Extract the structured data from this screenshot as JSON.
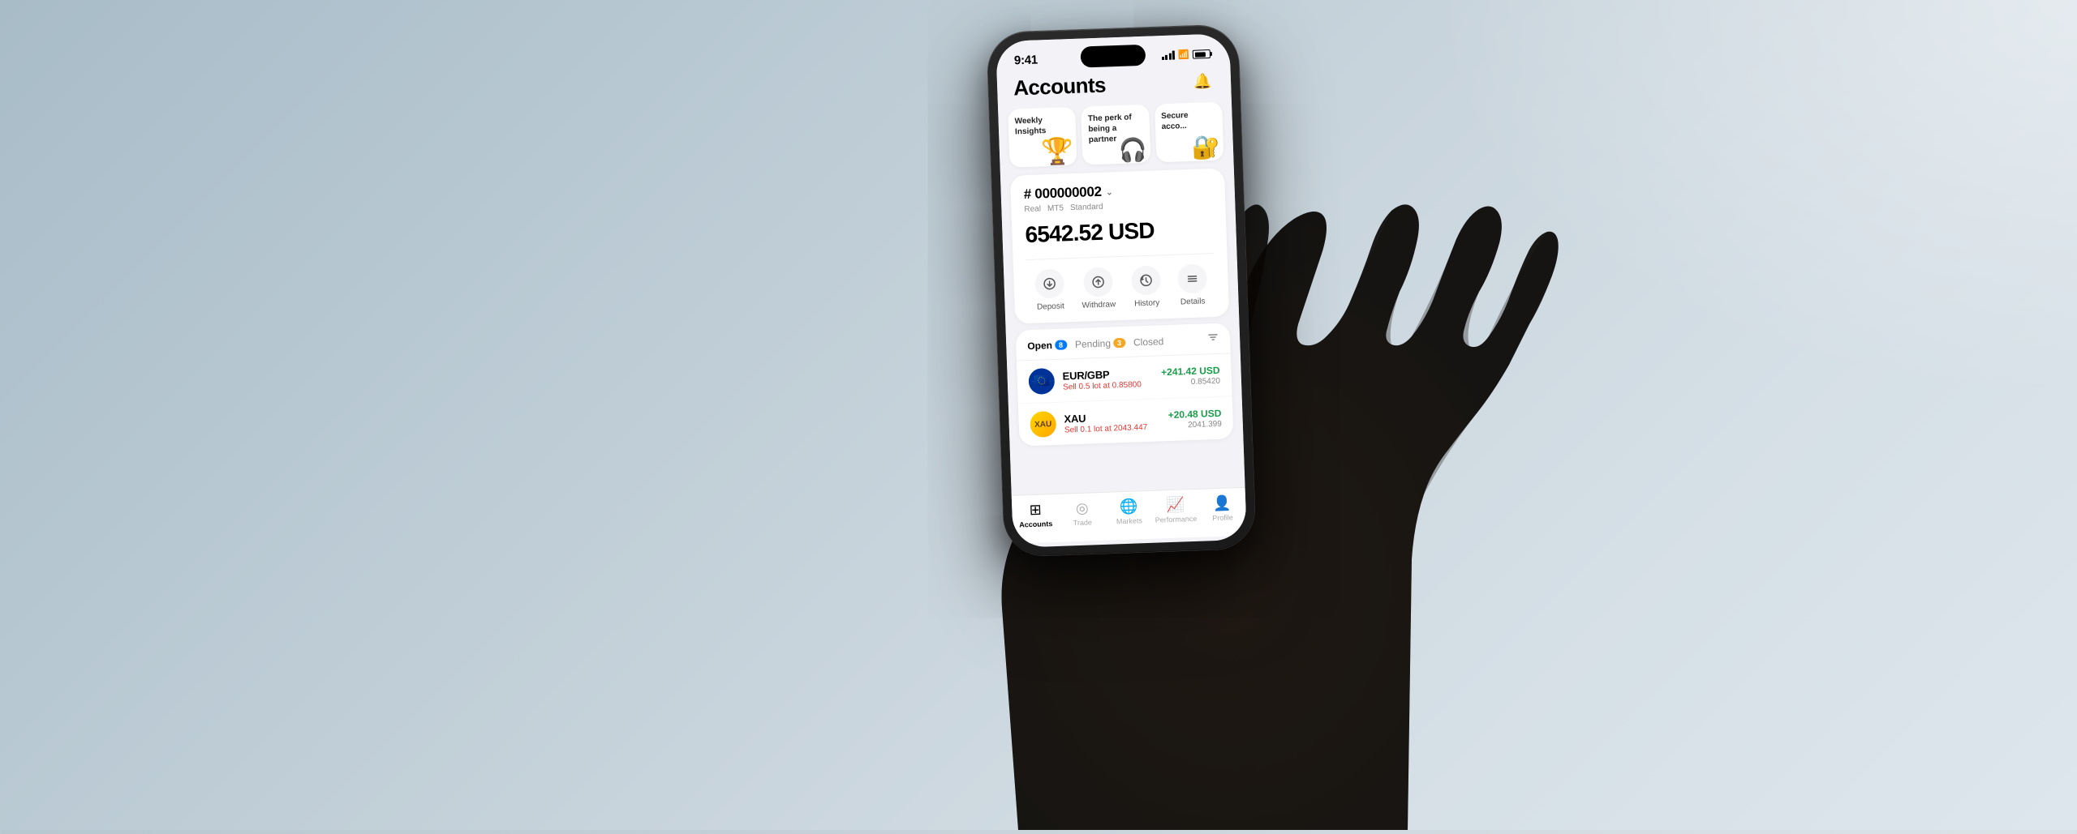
{
  "background": {
    "gradient": "linear-gradient(135deg, #b8c8d0 0%, #c5d0d8 30%, #d8e0e5 60%, #e0e8ec 100%)"
  },
  "status_bar": {
    "time": "9:41",
    "signal_label": "signal-bars-icon",
    "wifi_label": "wifi-icon",
    "battery_label": "battery-icon"
  },
  "header": {
    "title": "Accounts",
    "notification_icon": "bell-icon"
  },
  "promo_cards": [
    {
      "label": "Weekly Insights",
      "icon": "🏆",
      "bg": "#fff"
    },
    {
      "label": "The perk of being a partner",
      "icon": "🎧",
      "bg": "#fff"
    },
    {
      "label": "Secure acco...",
      "icon": "🔐",
      "bg": "#fff"
    }
  ],
  "account": {
    "number": "# 000000002",
    "has_chevron": true,
    "tags": [
      "Real",
      "MT5",
      "Standard"
    ],
    "balance": "6542.52 USD"
  },
  "action_buttons": [
    {
      "label": "Deposit",
      "icon": "⊕"
    },
    {
      "label": "Withdraw",
      "icon": "↑"
    },
    {
      "label": "History",
      "icon": "⟳"
    },
    {
      "label": "Details",
      "icon": "≡"
    }
  ],
  "trades": {
    "tabs": [
      {
        "label": "Open",
        "badge": "8",
        "badge_color": "blue",
        "active": true
      },
      {
        "label": "Pending",
        "badge": "3",
        "badge_color": "yellow",
        "active": false
      },
      {
        "label": "Closed",
        "badge": null,
        "active": false
      }
    ],
    "items": [
      {
        "symbol": "EUR/GBP",
        "detail": "Sell 0.5 lot at 0.85800",
        "pnl": "+241.42 USD",
        "price": "0.85420",
        "flag_type": "eu"
      },
      {
        "symbol": "XAU",
        "detail": "Sell 0.1 lot at 2043.447",
        "pnl": "+20.48 USD",
        "price": "2041.399",
        "flag_type": "xau"
      }
    ]
  },
  "bottom_nav": [
    {
      "label": "Accounts",
      "icon": "⊞",
      "active": true
    },
    {
      "label": "Trade",
      "icon": "◎",
      "active": false
    },
    {
      "label": "Markets",
      "icon": "🌐",
      "active": false
    },
    {
      "label": "Performance",
      "icon": "📊",
      "active": false
    },
    {
      "label": "Profile",
      "icon": "👤",
      "active": false
    }
  ]
}
